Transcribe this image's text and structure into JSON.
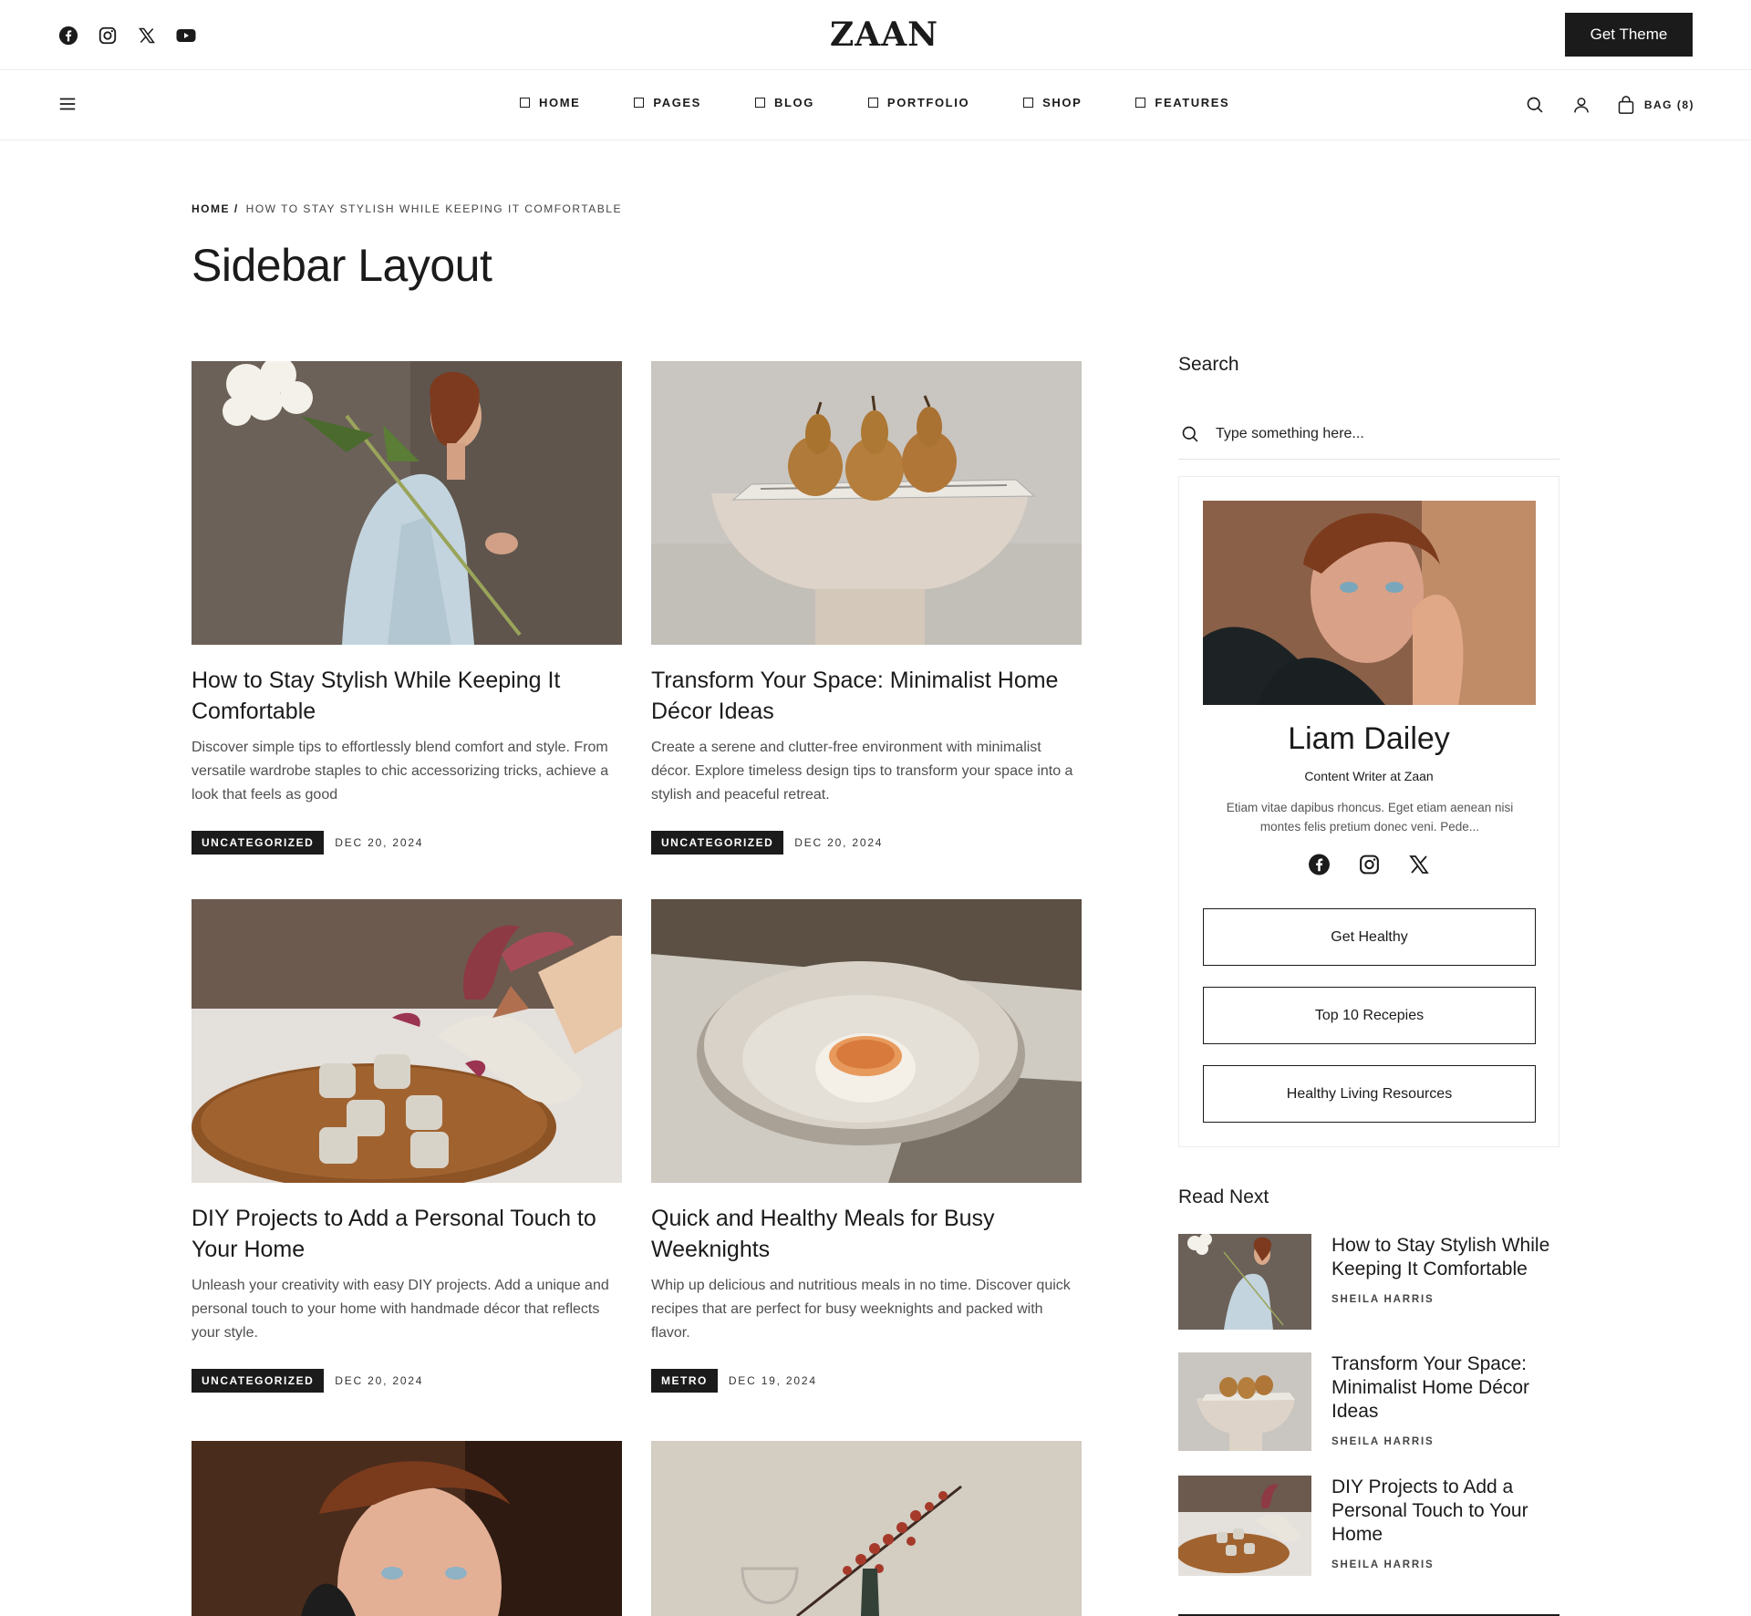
{
  "header": {
    "logo": "ZAAN",
    "cta": "Get Theme",
    "social_icons": [
      "facebook-icon",
      "instagram-icon",
      "x-icon",
      "youtube-icon"
    ]
  },
  "nav": {
    "items": [
      {
        "label": "HOME"
      },
      {
        "label": "PAGES"
      },
      {
        "label": "BLOG"
      },
      {
        "label": "PORTFOLIO"
      },
      {
        "label": "SHOP"
      },
      {
        "label": "FEATURES"
      }
    ],
    "bag_label": "BAG (8)"
  },
  "breadcrumb": {
    "home": "HOME /",
    "current": "HOW TO STAY STYLISH WHILE KEEPING IT COMFORTABLE"
  },
  "page_title": "Sidebar Layout",
  "posts": [
    {
      "title": "How to Stay Stylish While Keeping It Comfortable",
      "excerpt": "Discover simple tips to effortlessly blend comfort and style. From versatile wardrobe staples to chic accessorizing tricks, achieve a look that feels as good",
      "tag": "UNCATEGORIZED",
      "date": "DEC 20, 2024"
    },
    {
      "title": "Transform Your Space: Minimalist Home Décor Ideas",
      "excerpt": "Create a serene and clutter-free environment with minimalist décor. Explore timeless design tips to transform your space into a stylish and peaceful retreat.",
      "tag": "UNCATEGORIZED",
      "date": "DEC 20, 2024"
    },
    {
      "title": "DIY Projects to Add a Personal Touch to Your Home",
      "excerpt": "Unleash your creativity with easy DIY projects. Add a unique and personal touch to your home with handmade décor that reflects your style.",
      "tag": "UNCATEGORIZED",
      "date": "DEC 20, 2024"
    },
    {
      "title": "Quick and Healthy Meals for Busy Weeknights",
      "excerpt": "Whip up delicious and nutritious meals in no time. Discover quick recipes that are perfect for busy weeknights and packed with flavor.",
      "tag": "METRO",
      "date": "DEC 19, 2024"
    }
  ],
  "sidebar": {
    "search_title": "Search",
    "search_placeholder": "Type something here...",
    "author": {
      "name": "Liam Dailey",
      "role": "Content Writer at Zaan",
      "bio": "Etiam vitae dapibus rhoncus. Eget etiam aenean nisi montes felis pretium donec veni. Pede...",
      "social_icons": [
        "facebook-icon",
        "instagram-icon",
        "x-icon"
      ],
      "buttons": [
        "Get Healthy",
        "Top 10 Recepies",
        "Healthy Living Resources"
      ]
    },
    "read_next_title": "Read Next",
    "read_next": [
      {
        "title": "How to Stay Stylish While Keeping It Comfortable",
        "author": "SHEILA HARRIS"
      },
      {
        "title": "Transform Your Space: Minimalist Home Décor Ideas",
        "author": "SHEILA HARRIS"
      },
      {
        "title": "DIY Projects to Add a Personal Touch to Your Home",
        "author": "SHEILA HARRIS"
      }
    ]
  },
  "colors": {
    "accent": "#1b1b1b",
    "text_muted": "#4f4f4f",
    "border": "#ececec"
  }
}
